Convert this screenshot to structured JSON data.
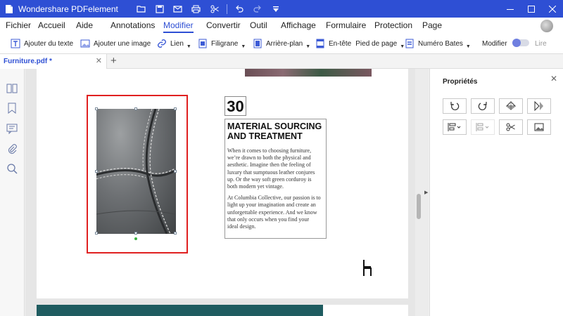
{
  "app": {
    "title": "Wondershare PDFelement"
  },
  "menu": [
    "Fichier",
    "Accueil",
    "Aide",
    "Annotations",
    "Modifier",
    "Convertir",
    "Outil",
    "Affichage",
    "Formulaire",
    "Protection",
    "Page"
  ],
  "toolbar": {
    "add_text": "Ajouter du texte",
    "add_image": "Ajouter une image",
    "link": "Lien",
    "watermark": "Filigrane",
    "background": "Arrière-plan",
    "header": "En-tête",
    "footer": "Pied de page",
    "bates": "Numéro Bates",
    "modify": "Modifier",
    "read": "Lire"
  },
  "tabs": {
    "file": "Furniture.pdf *"
  },
  "document": {
    "number": "30",
    "heading": "MATERIAL SOURCING\nAND TREATMENT",
    "paragraph1": "When it comes to choosing furniture,\nwe’re drawn to both the physical and\naesthetic. Imagine then the feeling of\nluxury that sumptuous leather conjures\nup. Or the way soft green corduroy is\nboth modern yet vintage.",
    "paragraph2": "At Columbia Collective, our passion is to\nlight up your imagination and create an\nunforgettable experience. And we know\nthat only occurs when you find your\nideal design."
  },
  "properties": {
    "title": "Propriétés"
  },
  "colors": {
    "brand": "#2e4fd4",
    "selection": "#e02020",
    "band": "#1f5c60"
  },
  "icons": [
    "undo-icon",
    "redo-icon",
    "save-icon",
    "mail-icon",
    "print-icon",
    "cut-icon",
    "rotate-left-icon",
    "rotate-right-icon",
    "flip-vertical-icon",
    "flip-horizontal-icon",
    "align-icon",
    "distribute-icon",
    "crop-icon",
    "replace-image-icon",
    "chair-icon"
  ]
}
